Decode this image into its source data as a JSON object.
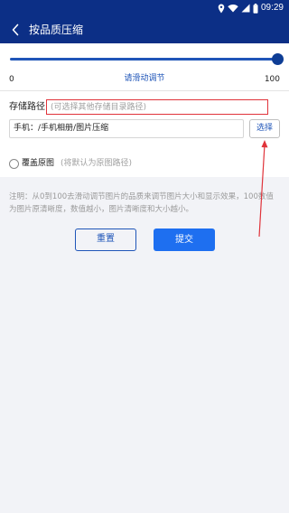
{
  "status_bar": {
    "time": "09:29",
    "icons": [
      "location-icon",
      "wifi-icon",
      "signal-icon",
      "battery-icon"
    ]
  },
  "app_bar": {
    "title": "按品质压缩",
    "back_icon": "chevron-left-icon"
  },
  "slider": {
    "min_label": "0",
    "title": "请滑动调节",
    "max_label": "100",
    "value": 100
  },
  "storage": {
    "label": "存储路径",
    "hint": "(可选择其他存储目录路径)",
    "path_value": "手机：/手机相册/图片压缩",
    "select_label": "选择"
  },
  "overwrite": {
    "label": "覆盖原图",
    "hint": "(将默认为原图路径)",
    "checked": false
  },
  "note": "注明：从0到100去滑动调节图片的品质来调节图片大小和显示效果，100数值为图片原清晰度，数值越小，图片清晰度和大小越小。",
  "actions": {
    "reset_label": "重置",
    "submit_label": "提交"
  },
  "colors": {
    "header_bg": "#0c2f86",
    "accent": "#1f55b8",
    "submit_bg": "#1e6ff0",
    "annotation": "#e0333a"
  }
}
